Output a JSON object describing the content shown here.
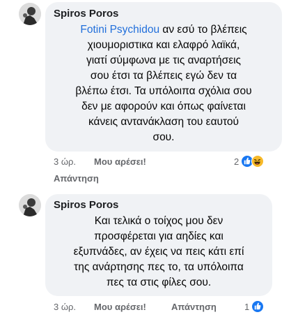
{
  "comments": [
    {
      "author": "Spiros Poros",
      "mention": "Fotini Psychidou",
      "lines": [
        " αν εσύ το βλέπεις",
        "χιουμοριστικα και ελαφρό λαϊκά,",
        "γιατί σύμφωνα με τις αναρτήσεις",
        "σου έτσι τα βλέπεις εγώ δεν τα",
        "βλέπω έτσι. Τα υπόλοιπα σχόλια σου",
        "δεν με αφορούν και όπως φαίνεται",
        "κάνεις αντανάκλαση του εαυτού",
        "σου."
      ],
      "time": "3 ώρ.",
      "like": "Μου αρέσει!",
      "reply": "Απάντηση",
      "reaction_count": "2",
      "reactions": [
        "like-icon",
        "haha-icon"
      ]
    },
    {
      "author": "Spiros Poros",
      "lines": [
        "Και τελικά ο τοίχος μου δεν",
        "προσφέρεται για αηδίες και",
        "εξυπνάδες, αν έχεις να πεις κάτι επί",
        "της ανάρτησης πες το, τα υπόλοιπα",
        "πες τα στις φίλες σου."
      ],
      "time": "3 ώρ.",
      "like": "Μου αρέσει!",
      "reply": "Απάντηση",
      "reaction_count": "1",
      "reactions": [
        "like-icon"
      ]
    }
  ],
  "colors": {
    "bubble": "#f0f2f5",
    "mention": "#216fdb",
    "meta": "#65676b",
    "like_blue": "#1877f2",
    "haha_yellow": "#f7b928"
  }
}
